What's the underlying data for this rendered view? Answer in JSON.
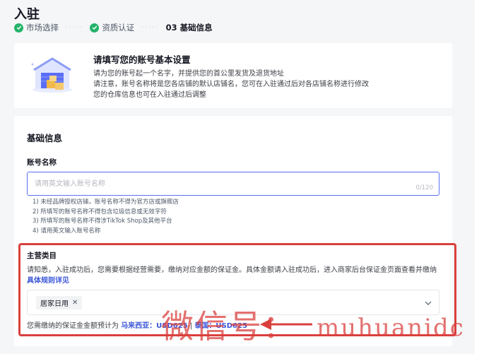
{
  "page": {
    "title": "入驻"
  },
  "steps": [
    {
      "label": "市场选择",
      "status": "done"
    },
    {
      "label": "资质认证",
      "status": "done"
    },
    {
      "number": "03",
      "label": "基础信息",
      "status": "active"
    }
  ],
  "intro": {
    "title": "请填写您的账号基本设置",
    "lines": [
      "请为您的账号起一个名字，并提供您的首公里发货及退货地址",
      "请注意，账号名称将是您各店铺的默认店铺名，您可在入驻通过后对各店铺名称进行修改",
      "您的仓库信息也可在入驻通过后调整"
    ]
  },
  "basic_info": {
    "section_title": "基础信息",
    "account_name": {
      "label": "账号名称",
      "value": "",
      "placeholder": "请用英文输入账号名称",
      "char_count": "0/120"
    },
    "rules": [
      "1) 未经品牌授权店铺，账号名称不得为官方店或旗舰店",
      "2) 所填写的账号名称不得包含垃圾信息或无效字符",
      "3) 所填写的账号名称不得涉TikTok Shop及其他平台",
      "4) 请用英文输入账号名称"
    ],
    "main_category": {
      "label": "主营类目",
      "notice": "请知悉，入驻成功后，您需要根据经营需要，缴纳对应金额的保证金。具体金额请入驻成功后，进入商家后台保证金页面查看并缴纳",
      "rule_link": "具体规则详见",
      "selected_tag": "居家日用",
      "deposit_prefix": "您需缴纳的保证金金额预计为",
      "deposit_my": "马来西亚：USD625",
      "deposit_sep": "|",
      "deposit_th": "泰国：USD625"
    }
  },
  "overlay": {
    "watermark_cn": "微信号：",
    "watermark_en": "muhuanidc"
  },
  "colors": {
    "accent": "#5b6ef7",
    "link": "#3a55d8",
    "success": "#24b36b",
    "highlight": "#d9403d"
  }
}
